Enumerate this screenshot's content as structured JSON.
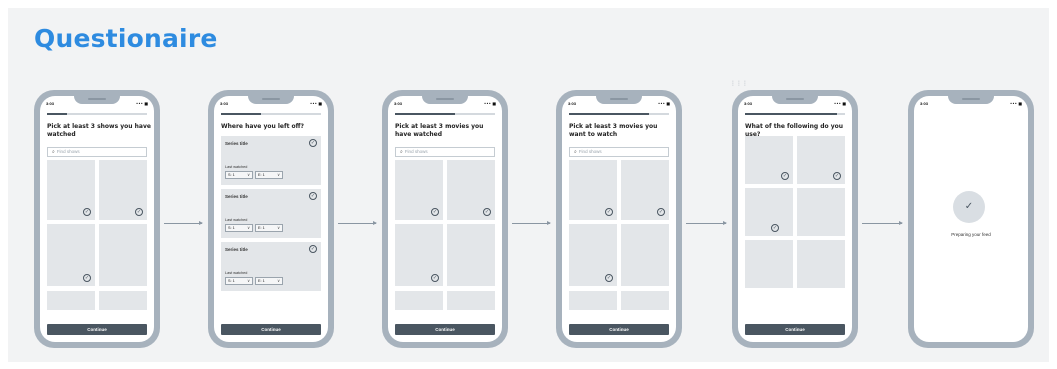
{
  "title": "Questionaire",
  "status": {
    "time": "3:03",
    "icons": "••• ■"
  },
  "icons": {
    "check": "✓",
    "search": "⌕",
    "chevron": "∨"
  },
  "screens": [
    {
      "progress": 0.2,
      "question": "Pick at least 3 shows you have watched",
      "search_placeholder": "Find shows",
      "cta": "Continue"
    },
    {
      "progress": 0.4,
      "question": "Where have you left off?",
      "cards": [
        {
          "title": "Series title",
          "last": "Last watched",
          "season": "S: 1",
          "episode": "E: 1"
        },
        {
          "title": "Series title",
          "last": "Last watched",
          "season": "S: 1",
          "episode": "E: 1"
        },
        {
          "title": "Series title",
          "last": "Last watched",
          "season": "S: 1",
          "episode": "E: 1"
        }
      ],
      "cta": "Continue"
    },
    {
      "progress": 0.6,
      "question": "Pick at least 3 movies you have watched",
      "search_placeholder": "Find shows",
      "cta": "Continue"
    },
    {
      "progress": 0.8,
      "question": "Pick at least 3 movies you want to watch",
      "search_placeholder": "Find shows",
      "cta": "Continue"
    },
    {
      "progress": 0.92,
      "question": "What of the following do you use?",
      "cta": "Continue"
    },
    {
      "progress": 1.0,
      "message": "Preparing your feed"
    }
  ]
}
